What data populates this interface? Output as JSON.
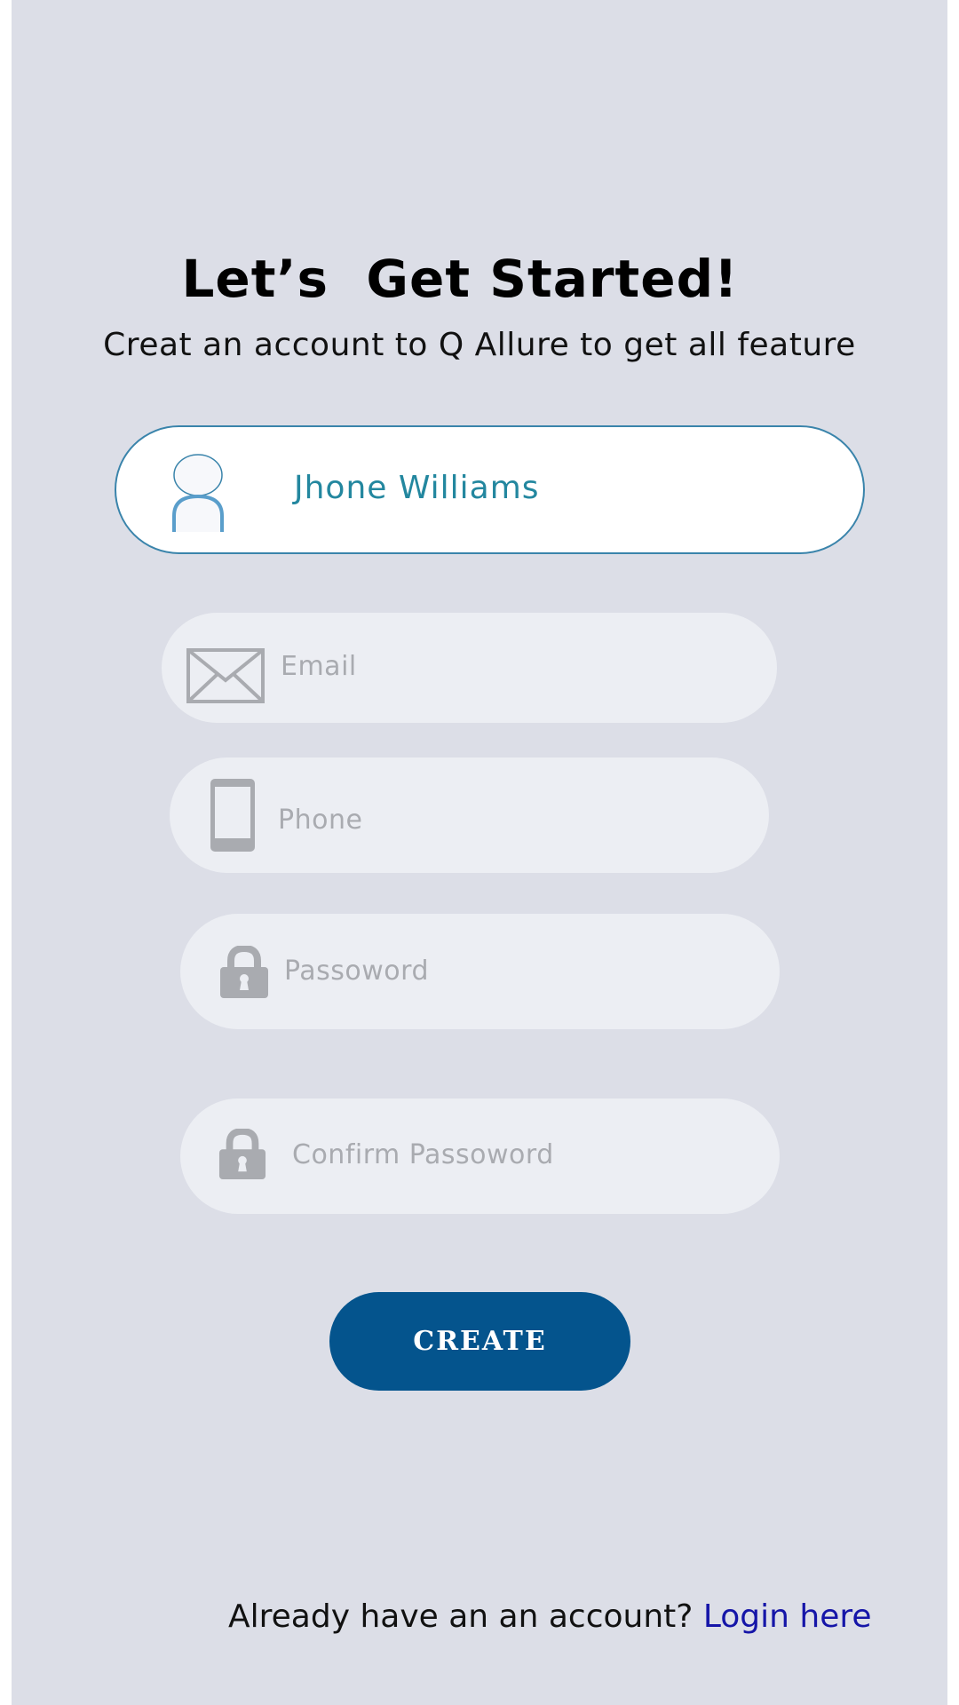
{
  "header": {
    "title": "Let’s  Get Started!",
    "subtitle": "Creat an account to Q Allure to get all feature"
  },
  "form": {
    "name": {
      "value": "Jhone Williams",
      "icon": "user-avatar-icon"
    },
    "email": {
      "placeholder": "Email",
      "icon": "envelope-icon"
    },
    "phone": {
      "placeholder": "Phone",
      "icon": "phone-icon"
    },
    "password": {
      "placeholder": "Passoword",
      "icon": "lock-icon"
    },
    "confirm_password": {
      "placeholder": "Confirm Passoword",
      "icon": "lock-icon"
    }
  },
  "actions": {
    "create_label": "CREATE"
  },
  "footer": {
    "prompt": "Already have an an account?",
    "login_link": "Login here"
  },
  "colors": {
    "background": "#dcdee7",
    "field_background": "#eceef3",
    "primary": "#04548d",
    "name_text": "#23879f",
    "link": "#1515a8",
    "placeholder": "#a9abb0"
  }
}
